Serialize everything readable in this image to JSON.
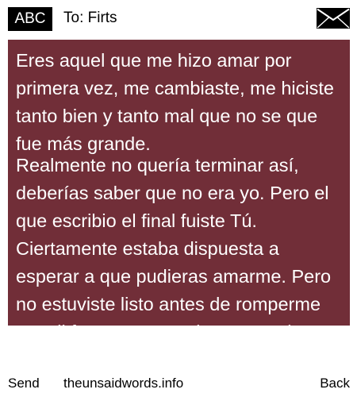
{
  "header": {
    "badge": "ABC",
    "to_label": "To: Firts",
    "icon": "envelope-icon"
  },
  "message": {
    "background": "#712e38",
    "text_color": "#ffffff",
    "paragraphs": [
      "Eres aquel que me hizo amar por primera vez, me cambiaste, me hiciste tanto bien y tanto mal que no se que fue más grande.",
      "Realmente no quería terminar así, deberías saber que no era yo. Pero el que escribio el final fuiste Tú. Ciertamente estaba dispuesta a esperar a que pudieras amarme. Pero no estuviste listo antes de romperme en mil fracmentos. Solo se que ahora ,lamentablemente al recordarte siento un peso desagradable, pero"
    ]
  },
  "footer": {
    "send": "Send",
    "site": "theunsaidwords.info",
    "back": "Back"
  }
}
